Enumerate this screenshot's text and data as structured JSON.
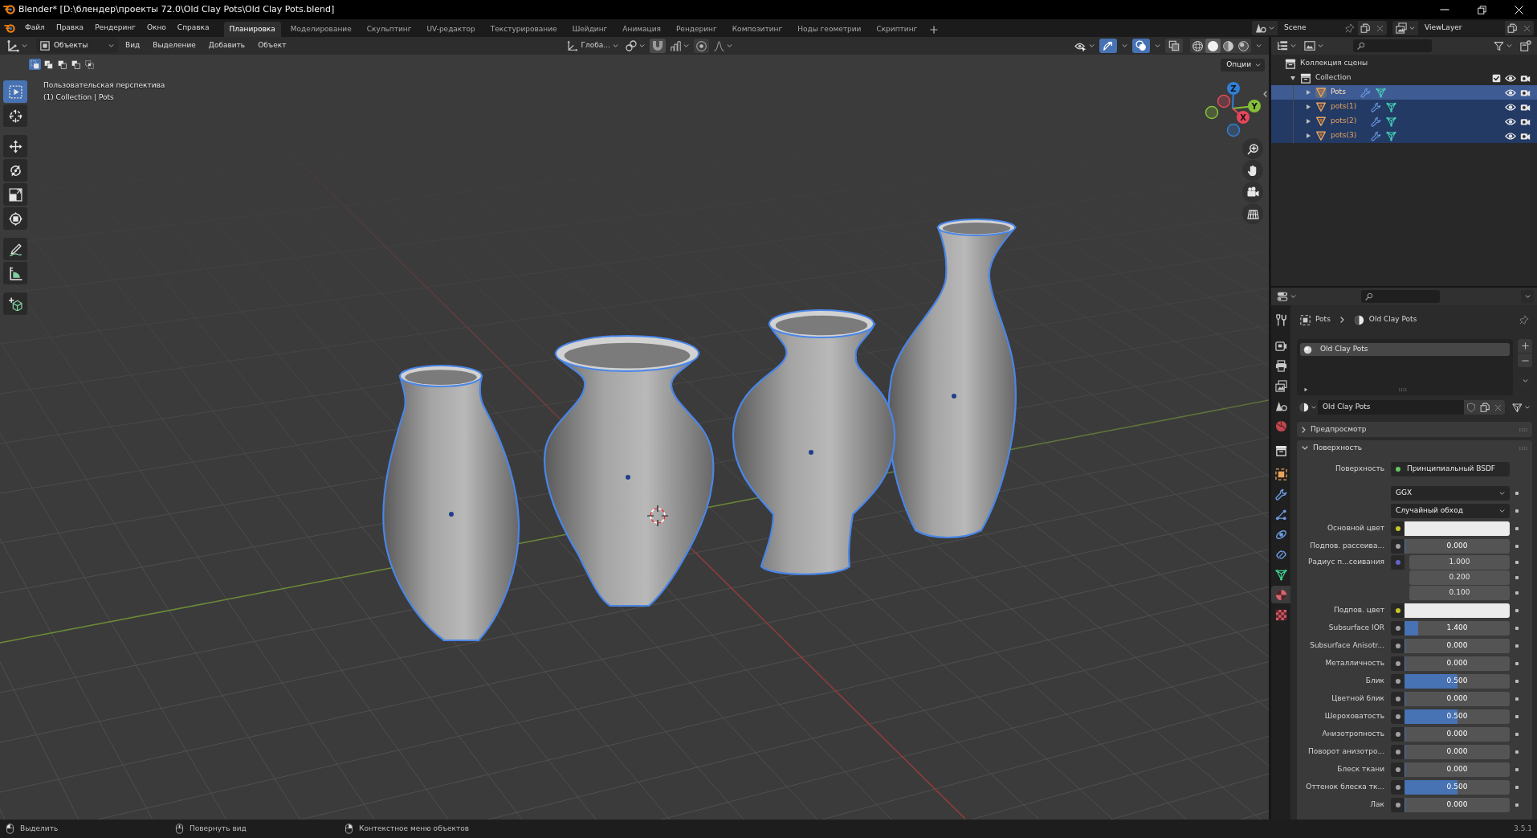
{
  "window": {
    "title": "Blender* [D:\\блендер\\проекты 72.0\\Old Clay Pots\\Old Clay Pots.blend]"
  },
  "menu": [
    "Файл",
    "Правка",
    "Рендеринг",
    "Окно",
    "Справка"
  ],
  "workspaces": [
    {
      "label": "Планировка",
      "selected": true
    },
    {
      "label": "Моделирование",
      "selected": false
    },
    {
      "label": "Скульптинг",
      "selected": false
    },
    {
      "label": "UV-редактор",
      "selected": false
    },
    {
      "label": "Текстурирование",
      "selected": false
    },
    {
      "label": "Шейдинг",
      "selected": false
    },
    {
      "label": "Анимация",
      "selected": false
    },
    {
      "label": "Рендеринг",
      "selected": false
    },
    {
      "label": "Композитинг",
      "selected": false
    },
    {
      "label": "Ноды геометрии",
      "selected": false
    },
    {
      "label": "Скриптинг",
      "selected": false
    }
  ],
  "scene": "Scene",
  "view_layer": "ViewLayer",
  "viewport": {
    "mode": "Объекты",
    "menus": [
      "Вид",
      "Выделение",
      "Добавить",
      "Объект"
    ],
    "orientation": "Глоба...",
    "toggles": [
      {
        "kind": "gizmos",
        "on": true
      },
      {
        "kind": "overlays",
        "on": true
      },
      {
        "kind": "xray",
        "on": false
      }
    ],
    "shading": [
      {
        "kind": "wireframe",
        "selected": false
      },
      {
        "kind": "solid",
        "selected": true
      },
      {
        "kind": "material",
        "selected": false
      },
      {
        "kind": "rendered",
        "selected": false
      }
    ],
    "options": "Опции",
    "selection_modes": [
      {
        "kind": "set",
        "selected": true
      },
      {
        "kind": "extend",
        "selected": false
      },
      {
        "kind": "subtract",
        "selected": false
      },
      {
        "kind": "difference",
        "selected": false
      },
      {
        "kind": "intersect",
        "selected": false
      }
    ],
    "view_name": "Пользовательская перспектива",
    "view_info": "(1) Collection | Pots",
    "tools": [
      {
        "kind": "select_box",
        "selected": true
      },
      {
        "kind": "cursor",
        "selected": false
      },
      {
        "kind": "move",
        "selected": false
      },
      {
        "kind": "rotate",
        "selected": false
      },
      {
        "kind": "scale",
        "selected": false
      },
      {
        "kind": "transform",
        "selected": false
      },
      {
        "kind": "annotate",
        "selected": false
      },
      {
        "kind": "measure",
        "selected": false
      },
      {
        "kind": "add_cube",
        "selected": false
      }
    ],
    "gizmo_axes": [
      {
        "kind": "x",
        "label": "X"
      },
      {
        "kind": "y",
        "label": "Y"
      },
      {
        "kind": "z",
        "label": "Z"
      }
    ],
    "objects": [
      {
        "kind": "slim_vase",
        "selected": true
      },
      {
        "kind": "wide_vase",
        "selected": true
      },
      {
        "kind": "round_vase",
        "selected": true
      },
      {
        "kind": "tall_vase",
        "selected": true
      }
    ]
  },
  "outliner": {
    "tree": [
      {
        "kind": "scene_collection",
        "label": "Коллекция сцены",
        "selected": false,
        "active": false,
        "children": [
          {
            "kind": "collection",
            "label": "Collection",
            "expanded": true,
            "checked": true,
            "visible": true,
            "renderable": true,
            "selected": false,
            "active": false,
            "children": [
              {
                "kind": "mesh_object",
                "label": "Pots",
                "expanded": false,
                "visible": true,
                "renderable": true,
                "selected": true,
                "active": true
              },
              {
                "kind": "mesh_object",
                "label": "pots(1)",
                "expanded": false,
                "visible": true,
                "renderable": true,
                "selected": true,
                "active": false
              },
              {
                "kind": "mesh_object",
                "label": "pots(2)",
                "expanded": false,
                "visible": true,
                "renderable": true,
                "selected": true,
                "active": false
              },
              {
                "kind": "mesh_object",
                "label": "pots(3)",
                "expanded": false,
                "visible": true,
                "renderable": true,
                "selected": true,
                "active": false
              }
            ]
          }
        ]
      }
    ]
  },
  "properties": {
    "tabs": [
      {
        "kind": "tool",
        "selected": false
      },
      {
        "kind": "render",
        "selected": false
      },
      {
        "kind": "output",
        "selected": false
      },
      {
        "kind": "view_layer",
        "selected": false
      },
      {
        "kind": "scene",
        "selected": false
      },
      {
        "kind": "world",
        "selected": false
      },
      {
        "kind": "collection",
        "selected": false
      },
      {
        "kind": "object",
        "selected": false
      },
      {
        "kind": "modifiers",
        "selected": false
      },
      {
        "kind": "particles",
        "selected": false
      },
      {
        "kind": "physics",
        "selected": false
      },
      {
        "kind": "constraints",
        "selected": false
      },
      {
        "kind": "data",
        "selected": false
      },
      {
        "kind": "material",
        "selected": true
      },
      {
        "kind": "texture",
        "selected": false
      }
    ],
    "breadcrumb": [
      {
        "kind": "object",
        "label": "Pots"
      },
      {
        "kind": "material",
        "label": "Old Clay Pots"
      }
    ],
    "material_slots": [
      {
        "name": "Old Clay Pots",
        "selected": true
      }
    ],
    "material": "Old Clay Pots",
    "panels": [
      {
        "title": "Предпросмотр",
        "expanded": false
      },
      {
        "title": "Поверхность",
        "expanded": true,
        "rows": [
          {
            "kind": "link",
            "label": "Поверхность",
            "color": "#63c763",
            "value": "Принципиальный BSDF"
          },
          {
            "kind": "dropdown",
            "value": "GGX"
          },
          {
            "kind": "dropdown",
            "value": "Случайный обход"
          },
          {
            "kind": "color",
            "label": "Основной цвет",
            "color": "#c7c729",
            "swatch": {
              "color": "#ececec"
            }
          },
          {
            "kind": "slider",
            "label": "Подпов. рассеива...",
            "color": "#a1a1a1",
            "value": "0.000",
            "level": 0
          },
          {
            "kind": "vector",
            "label": "Радиус п...сеивания",
            "color": "#6363c7",
            "values": [
              "1.000",
              "0.200",
              "0.100"
            ]
          },
          {
            "kind": "color",
            "label": "Подпов. цвет",
            "color": "#c7c729",
            "swatch": {
              "color": "#ececec"
            }
          },
          {
            "kind": "slider",
            "label": "Subsurface IOR",
            "color": "#a1a1a1",
            "value": "1.400",
            "level": 0.13
          },
          {
            "kind": "slider",
            "label": "Subsurface Anisotr...",
            "color": "#a1a1a1",
            "value": "0.000",
            "level": 0
          },
          {
            "kind": "slider",
            "label": "Металличность",
            "color": "#a1a1a1",
            "value": "0.000",
            "level": 0
          },
          {
            "kind": "slider",
            "label": "Блик",
            "color": "#a1a1a1",
            "value": "0.500",
            "level": 0.5
          },
          {
            "kind": "slider",
            "label": "Цветной блик",
            "color": "#a1a1a1",
            "value": "0.000",
            "level": 0
          },
          {
            "kind": "slider",
            "label": "Шероховатость",
            "color": "#a1a1a1",
            "value": "0.500",
            "level": 0.5
          },
          {
            "kind": "slider",
            "label": "Анизотропность",
            "color": "#a1a1a1",
            "value": "0.000",
            "level": 0
          },
          {
            "kind": "slider",
            "label": "Поворот анизотро...",
            "color": "#a1a1a1",
            "value": "0.000",
            "level": 0
          },
          {
            "kind": "slider",
            "label": "Блеск ткани",
            "color": "#a1a1a1",
            "value": "0.000",
            "level": 0
          },
          {
            "kind": "slider",
            "label": "Оттенок блеска тк...",
            "color": "#a1a1a1",
            "value": "0.500",
            "level": 0.5
          },
          {
            "kind": "slider",
            "label": "Лак",
            "color": "#a1a1a1",
            "value": "0.000",
            "level": 0
          }
        ]
      }
    ]
  },
  "status_bar": {
    "hints": [
      {
        "kind": "left",
        "label": "Выделить"
      },
      {
        "kind": "middle",
        "label": "Повернуть вид"
      },
      {
        "kind": "right",
        "label": "Контекстное меню объектов"
      }
    ],
    "version": "3.5.1"
  }
}
